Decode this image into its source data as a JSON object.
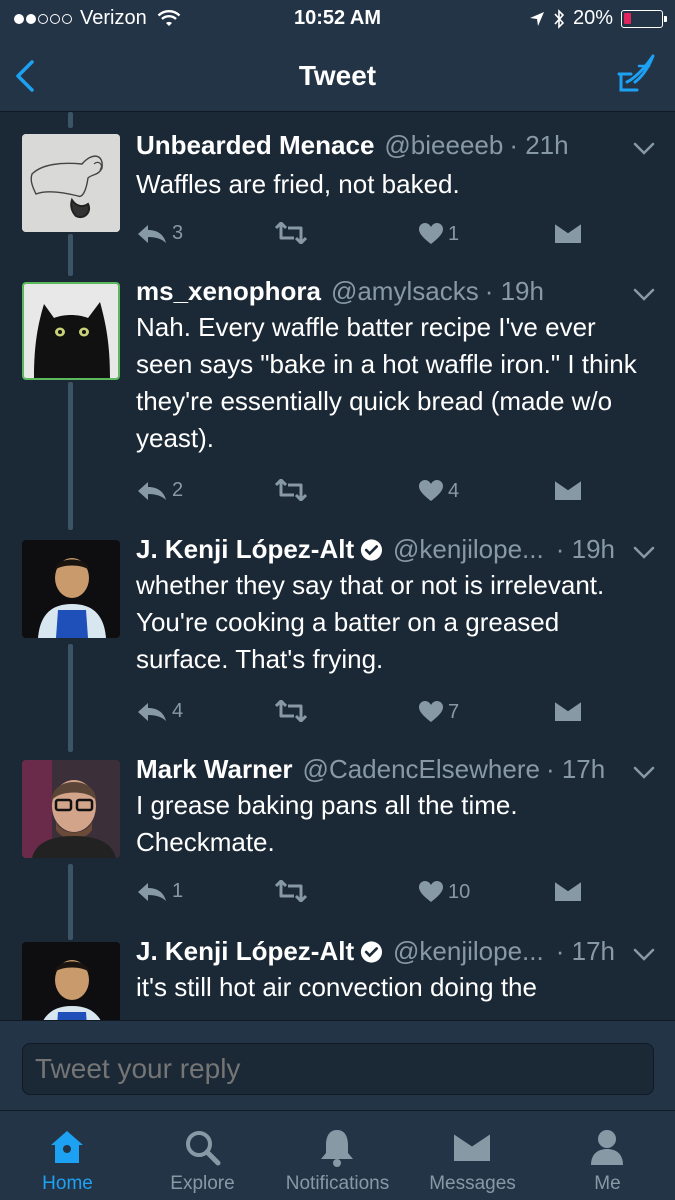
{
  "status_bar": {
    "carrier": "Verizon",
    "time": "10:52 AM",
    "battery": "20%",
    "battery_level": 0.2,
    "signal_bars_filled": 2,
    "signal_bars_total": 5
  },
  "nav": {
    "title": "Tweet",
    "back_icon": "chevron-left-icon",
    "compose_icon": "compose-tweet-icon"
  },
  "tweets": [
    {
      "name": "Unbearded Menace",
      "handle": "@bieeeeb",
      "time": "· 21h",
      "verified": false,
      "text": "Waffles are fried, not baked.",
      "replies": "3",
      "retweets": "",
      "likes": "1",
      "avatar": "sketch-drawing-avatar"
    },
    {
      "name": "ms_xenophora",
      "handle": "@amylsacks",
      "time": "· 19h",
      "verified": false,
      "text": "Nah. Every waffle batter recipe I've ever seen says \"bake in a hot waffle iron.\" I think they're essentially quick bread (made w/o yeast).",
      "replies": "2",
      "retweets": "",
      "likes": "4",
      "avatar": "black-cat-avatar"
    },
    {
      "name": "J. Kenji López-Alt",
      "handle": "@kenjilope...",
      "time": "· 19h",
      "verified": true,
      "text": "whether they say that or not is irrelevant. You're cooking a batter on a greased surface. That's frying.",
      "replies": "4",
      "retweets": "",
      "likes": "7",
      "avatar": "chef-apron-avatar"
    },
    {
      "name": "Mark Warner",
      "handle": "@CadencElsewhere",
      "time": "· 17h",
      "verified": false,
      "text": "I grease baking pans all the time. Checkmate.",
      "replies": "1",
      "retweets": "",
      "likes": "10",
      "avatar": "glasses-man-avatar"
    },
    {
      "name": "J. Kenji López-Alt",
      "handle": "@kenjilope...",
      "time": "· 17h",
      "verified": true,
      "text": "it's still hot air convection doing the",
      "replies": "",
      "retweets": "",
      "likes": "",
      "avatar": "chef-apron-avatar"
    }
  ],
  "reply": {
    "placeholder": "Tweet your reply"
  },
  "tabs": [
    {
      "label": "Home",
      "icon": "home-icon",
      "active": true
    },
    {
      "label": "Explore",
      "icon": "search-icon",
      "active": false
    },
    {
      "label": "Notifications",
      "icon": "bell-icon",
      "active": false
    },
    {
      "label": "Messages",
      "icon": "envelope-icon",
      "active": false
    },
    {
      "label": "Me",
      "icon": "person-icon",
      "active": false
    }
  ],
  "colors": {
    "background": "#1b2836",
    "bar": "#243447",
    "accent": "#1da1f2",
    "muted": "#8899a6",
    "battery_low": "#e0245e"
  }
}
